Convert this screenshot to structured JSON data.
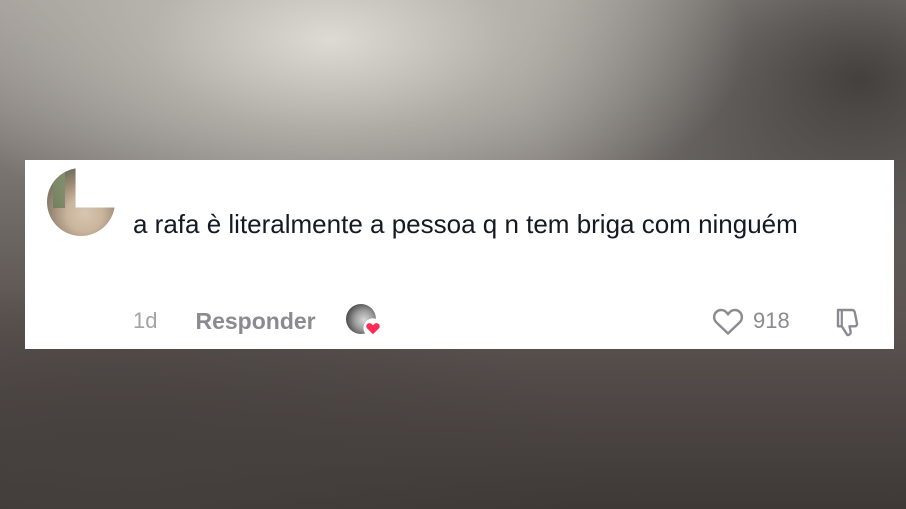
{
  "comment": {
    "avatar_icon": "user-avatar-photo",
    "text": "a rafa è literalmente a pessoa q n tem briga com ninguém",
    "time": "1d",
    "reply_label": "Responder",
    "creator_liked": true,
    "creator_like_icon": "creator-avatar-with-heart",
    "like_icon": "heart-outline-icon",
    "like_count": "918",
    "dislike_icon": "thumbs-down-icon"
  },
  "colors": {
    "card_background": "#ffffff",
    "text_primary": "#161823",
    "text_secondary": "#8a8a90",
    "heart_accent": "#fe2c55"
  }
}
